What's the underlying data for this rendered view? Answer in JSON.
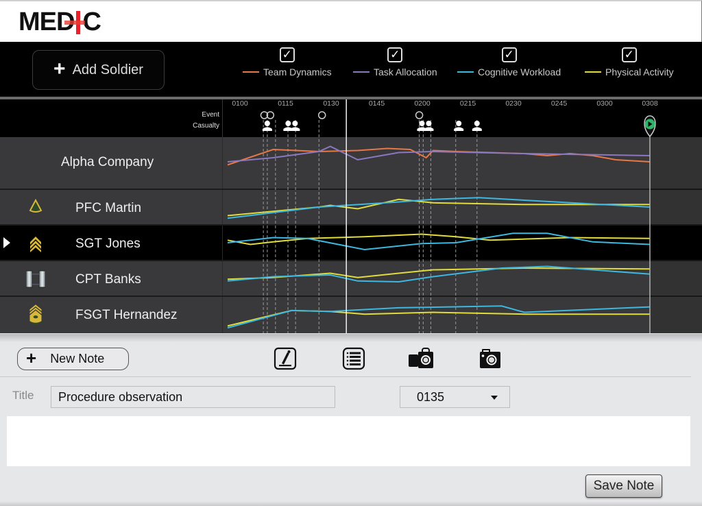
{
  "app": {
    "logo_text_left": "MED",
    "logo_text_right": "C",
    "logo_accent": "#e8212a"
  },
  "toolbar": {
    "add_soldier_label": "Add Soldier",
    "legend": [
      {
        "label": "Team Dynamics",
        "color": "#e87846",
        "checked": true,
        "check_glyph": "✓"
      },
      {
        "label": "Task Allocation",
        "color": "#8a78c0",
        "checked": true,
        "check_glyph": "✓"
      },
      {
        "label": "Cognitive Workload",
        "color": "#3db8e0",
        "checked": true,
        "check_glyph": "✓"
      },
      {
        "label": "Physical Activity",
        "color": "#e2dc3a",
        "checked": true,
        "check_glyph": "✓"
      }
    ]
  },
  "timeline": {
    "row_labels": {
      "event": "Event",
      "casualty": "Casualty"
    },
    "ticks": [
      "0100",
      "0115",
      "0130",
      "0145",
      "0200",
      "0215",
      "0230",
      "0245",
      "0300",
      "0308"
    ],
    "current_time": "0135",
    "end_time": "0308",
    "events_minutes": [
      8,
      10,
      27,
      59
    ],
    "casualties": [
      {
        "minute": 9,
        "count": 1
      },
      {
        "minute": 17,
        "count": 2
      },
      {
        "minute": 61,
        "count": 2
      },
      {
        "minute": 72,
        "count": 1
      },
      {
        "minute": 78,
        "count": 1
      }
    ],
    "marker_minutes": [
      7.7,
      9,
      11.7,
      15.8,
      18.3,
      26,
      59,
      60.3,
      62.8,
      71,
      78
    ]
  },
  "rows": [
    {
      "name": "Alpha Company",
      "rank_icon": "none",
      "selected": false,
      "series": {
        "team_dynamics": [
          [
            0,
            27
          ],
          [
            20,
            12
          ],
          [
            40,
            14
          ],
          [
            57,
            13
          ],
          [
            70,
            11
          ],
          [
            80,
            12
          ],
          [
            87,
            20
          ],
          [
            90,
            13
          ],
          [
            100,
            14
          ],
          [
            130,
            16
          ],
          [
            140,
            18
          ],
          [
            150,
            16
          ],
          [
            160,
            18
          ],
          [
            170,
            22
          ],
          [
            185,
            24
          ]
        ],
        "task_allocation": [
          [
            0,
            24
          ],
          [
            20,
            20
          ],
          [
            40,
            14
          ],
          [
            45,
            9
          ],
          [
            57,
            22
          ],
          [
            75,
            15
          ],
          [
            90,
            14
          ],
          [
            130,
            16
          ],
          [
            185,
            18
          ]
        ]
      }
    },
    {
      "name": "PFC Martin",
      "rank_icon": "pfc-chevron-icon",
      "selected": false,
      "series": {
        "physical_activity": [
          [
            0,
            30
          ],
          [
            40,
            20
          ],
          [
            45,
            18
          ],
          [
            57,
            22
          ],
          [
            75,
            11
          ],
          [
            90,
            15
          ],
          [
            130,
            17
          ],
          [
            185,
            17
          ]
        ],
        "cognitive_workload": [
          [
            0,
            33
          ],
          [
            40,
            20
          ],
          [
            75,
            14
          ],
          [
            90,
            11
          ],
          [
            110,
            9
          ],
          [
            130,
            12
          ],
          [
            185,
            20
          ]
        ]
      }
    },
    {
      "name": "SGT Jones",
      "rank_icon": "sgt-chevron-icon",
      "selected": true,
      "series": {
        "physical_activity": [
          [
            0,
            17
          ],
          [
            10,
            22
          ],
          [
            20,
            19
          ],
          [
            35,
            15
          ],
          [
            60,
            13
          ],
          [
            85,
            10
          ],
          [
            100,
            13
          ],
          [
            115,
            17
          ],
          [
            150,
            14
          ],
          [
            185,
            15
          ]
        ],
        "cognitive_workload": [
          [
            0,
            20
          ],
          [
            20,
            14
          ],
          [
            35,
            15
          ],
          [
            60,
            28
          ],
          [
            85,
            21
          ],
          [
            100,
            20
          ],
          [
            125,
            9
          ],
          [
            140,
            9
          ],
          [
            160,
            19
          ],
          [
            185,
            22
          ]
        ]
      }
    },
    {
      "name": "CPT Banks",
      "rank_icon": "cpt-bars-icon",
      "selected": false,
      "series": {
        "physical_activity": [
          [
            0,
            21
          ],
          [
            20,
            19
          ],
          [
            45,
            14
          ],
          [
            57,
            19
          ],
          [
            75,
            14
          ],
          [
            90,
            10
          ],
          [
            130,
            8
          ],
          [
            185,
            9
          ]
        ],
        "cognitive_workload": [
          [
            0,
            23
          ],
          [
            20,
            18
          ],
          [
            45,
            16
          ],
          [
            57,
            23
          ],
          [
            75,
            24
          ],
          [
            90,
            18
          ],
          [
            120,
            8
          ],
          [
            140,
            6
          ],
          [
            160,
            10
          ],
          [
            185,
            15
          ]
        ]
      }
    },
    {
      "name": "FSGT Hernandez",
      "rank_icon": "fsgt-chevron-icon",
      "selected": false,
      "series": {
        "physical_activity": [
          [
            0,
            32
          ],
          [
            28,
            15
          ],
          [
            45,
            16
          ],
          [
            60,
            19
          ],
          [
            90,
            17
          ],
          [
            130,
            19
          ],
          [
            185,
            19
          ]
        ],
        "cognitive_workload": [
          [
            0,
            34
          ],
          [
            28,
            15
          ],
          [
            45,
            16
          ],
          [
            75,
            12
          ],
          [
            120,
            10
          ],
          [
            130,
            17
          ],
          [
            185,
            11
          ]
        ]
      }
    }
  ],
  "notes": {
    "new_note_label": "New Note",
    "tools": [
      "edit-note-icon",
      "list-icon",
      "video-camera-icon",
      "photo-camera-icon"
    ],
    "title_label": "Title",
    "title_value": "Procedure observation",
    "time_value": "0135",
    "body_value": "",
    "save_label": "Save Note"
  }
}
